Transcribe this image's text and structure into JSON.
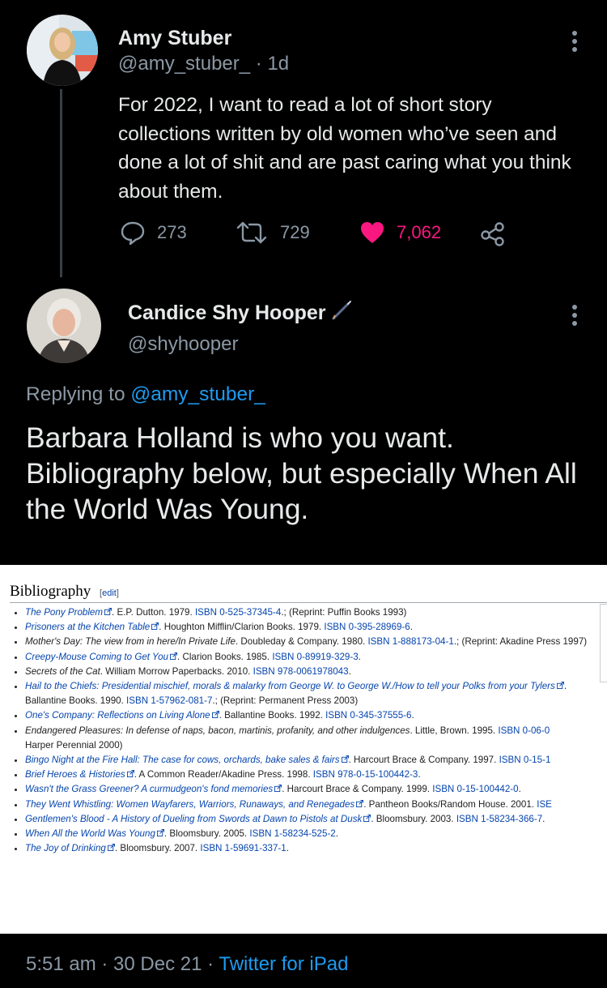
{
  "tweet1": {
    "name": "Amy Stuber",
    "handle": "@amy_stuber_",
    "time": "· 1d",
    "text": "For 2022, I want to read a lot of short story collections written by old women who’ve seen and done a lot of shit and are past caring what you think about them.",
    "replies": "273",
    "retweets": "729",
    "likes": "7,062",
    "like_color": "#f91880"
  },
  "tweet2": {
    "name": "Candice Shy Hooper",
    "handle": "@shyhooper",
    "replying_prefix": "Replying to ",
    "replying_to": "@amy_stuber_",
    "text": "Barbara Holland is who you want. Bibliography below, but especially When All the World Was Young."
  },
  "bibliography": {
    "heading": "Bibliography",
    "edit_open": "[",
    "edit": "edit",
    "edit_close": "]",
    "items": [
      {
        "title": "The Pony Problem",
        "rest_plain": ". E.P. Dutton. 1979. ",
        "isbn_label": "ISBN",
        "isbn": "0-525-37345-4",
        "tail": ".; (Reprint: Puffin Books 1993)"
      },
      {
        "title": "Prisoners at the Kitchen Table",
        "rest_plain": ". Houghton Mifflin/Clarion Books. 1979. ",
        "isbn_label": "ISBN",
        "isbn": "0-395-28969-6",
        "tail": "."
      },
      {
        "title": "Mother's Day: The view from in here/In Private Life",
        "rest_plain": ". Doubleday & Company. 1980. ",
        "isbn_label": "ISBN",
        "isbn": "1-888173-04-1",
        "tail": ".; (Reprint: Akadine Press 1997)"
      },
      {
        "title": "Creepy-Mouse Coming to Get You",
        "rest_plain": ". Clarion Books. 1985. ",
        "isbn_label": "ISBN",
        "isbn": "0-89919-329-3",
        "tail": "."
      },
      {
        "title": "Secrets of the Cat",
        "rest_plain": ". William Morrow Paperbacks. 2010. ",
        "isbn_label": "ISBN",
        "isbn": "978-0061978043",
        "tail": "."
      },
      {
        "title": "Hail to the Chiefs: Presidential mischief, morals & malarky from George W. to George W./How to tell your Polks from your Tylers",
        "rest_plain": ". Ballantine Books. 1990. ",
        "isbn_label": "ISBN",
        "isbn": "1-57962-081-7",
        "tail": ".; (Reprint: Permanent Press 2003)"
      },
      {
        "title": "One's Company: Reflections on Living Alone",
        "rest_plain": ". Ballantine Books. 1992. ",
        "isbn_label": "ISBN",
        "isbn": "0-345-37555-6",
        "tail": "."
      },
      {
        "title": "Endangered Pleasures: In defense of naps, bacon, martinis, profanity, and other indulgences",
        "rest_plain": ". Little, Brown. 1995. ",
        "isbn_label": "ISBN",
        "isbn": "0-06-0",
        "tail": "Harper Perennial 2000)"
      },
      {
        "title": "Bingo Night at the Fire Hall: The case for cows, orchards, bake sales & fairs",
        "rest_plain": ". Harcourt Brace & Company. 1997. ",
        "isbn_label": "ISBN",
        "isbn": "0-15-1",
        "tail": ""
      },
      {
        "title": "Brief Heroes & Histories",
        "rest_plain": ". A Common Reader/Akadine Press. 1998. ",
        "isbn_label": "ISBN",
        "isbn": "978-0-15-100442-3",
        "tail": "."
      },
      {
        "title": "Wasn't the Grass Greener? A curmudgeon's fond memories",
        "rest_plain": ". Harcourt Brace & Company. 1999. ",
        "isbn_label": "ISBN",
        "isbn": "0-15-100442-0",
        "tail": "."
      },
      {
        "title": "They Went Whistling: Women Wayfarers, Warriors, Runaways, and Renegades",
        "rest_plain": ". Pantheon Books/Random House. 2001. ",
        "isbn_label": "ISE",
        "isbn": "",
        "tail": ""
      },
      {
        "title": "Gentlemen's Blood - A History of Dueling from Swords at Dawn to Pistols at Dusk",
        "rest_plain": ". Bloomsbury. 2003. ",
        "isbn_label": "ISBN",
        "isbn": "1-58234-366-7",
        "tail": "."
      },
      {
        "title": "When All the World Was Young",
        "rest_plain": ". Bloomsbury. 2005. ",
        "isbn_label": "ISBN",
        "isbn": "1-58234-525-2",
        "tail": "."
      },
      {
        "title": "The Joy of Drinking",
        "rest_plain": ". Bloomsbury. 2007. ",
        "isbn_label": "ISBN",
        "isbn": "1-59691-337-1",
        "tail": "."
      }
    ]
  },
  "footer": {
    "time": "5:51 am · 30 Dec 21 · ",
    "source": "Twitter for iPad"
  }
}
